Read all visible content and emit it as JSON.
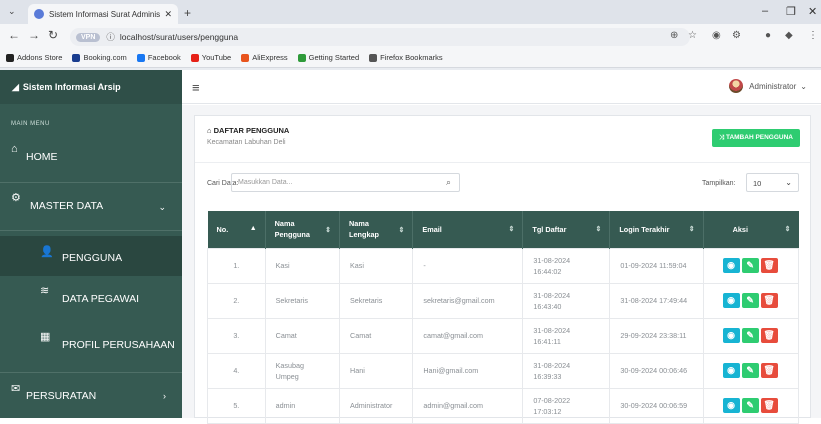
{
  "browser": {
    "tab_title": "Sistem Informasi Surat Adminis",
    "url": "localhost/surat/users/pengguna",
    "vpn_label": "VPN",
    "bookmarks": [
      {
        "label": "Addons Store",
        "color": "#222222"
      },
      {
        "label": "Booking.com",
        "color": "#1a3d8f"
      },
      {
        "label": "Facebook",
        "color": "#1877f2"
      },
      {
        "label": "YouTube",
        "color": "#e62117"
      },
      {
        "label": "AliExpress",
        "color": "#e8541d"
      },
      {
        "label": "Getting Started",
        "color": "#2e9a3a"
      },
      {
        "label": "Firefox Bookmarks",
        "color": "#555555"
      }
    ]
  },
  "sidebar": {
    "brand": "Sistem Informasi Arsip",
    "menu_label": "MAIN MENU",
    "items": [
      {
        "label": "HOME",
        "icon": "home-icon"
      },
      {
        "label": "MASTER DATA",
        "icon": "gear-icon"
      },
      {
        "label": "PENGGUNA",
        "icon": "user-icon"
      },
      {
        "label": "DATA PEGAWAI",
        "icon": "database-icon"
      },
      {
        "label": "PROFIL PERUSAHAAN",
        "icon": "building-icon"
      },
      {
        "label": "PERSURATAN",
        "icon": "mail-icon"
      }
    ]
  },
  "topbar": {
    "user": "Administrator"
  },
  "card": {
    "title": "DAFTAR PENGGUNA",
    "subtitle": "Kecamatan Labuhan Deli",
    "add_button": "TAMBAH PENGGUNA",
    "search_label": "Cari Data:",
    "search_placeholder": "Masukkan Data...",
    "show_label": "Tampilkan:",
    "show_value": "10"
  },
  "table": {
    "headers": [
      "No.",
      "Nama Pengguna",
      "Nama Lengkap",
      "Email",
      "Tgl Daftar",
      "Login Terakhir",
      "Aksi"
    ],
    "rows": [
      {
        "no": "1.",
        "username": "Kasi",
        "fullname": "Kasi",
        "email": "-",
        "registered": "31-08-2024 16:44:02",
        "last_login": "01-09-2024 11:59:04"
      },
      {
        "no": "2.",
        "username": "Sekretaris",
        "fullname": "Sekretaris",
        "email": "sekretaris@gmail.com",
        "registered": "31-08-2024 16:43:40",
        "last_login": "31-08-2024 17:49:44"
      },
      {
        "no": "3.",
        "username": "Camat",
        "fullname": "Camat",
        "email": "camat@gmail.com",
        "registered": "31-08-2024 16:41:11",
        "last_login": "29-09-2024 23:38:11"
      },
      {
        "no": "4.",
        "username": "Kasubag Umpeg",
        "fullname": "Hani",
        "email": "Hani@gmail.com",
        "registered": "31-08-2024 16:39:33",
        "last_login": "30-09-2024 00:06:46"
      },
      {
        "no": "5.",
        "username": "admin",
        "fullname": "Administrator",
        "email": "admin@gmail.com",
        "registered": "07-08-2022 17:03:12",
        "last_login": "30-09-2024 00:06:59"
      }
    ]
  }
}
